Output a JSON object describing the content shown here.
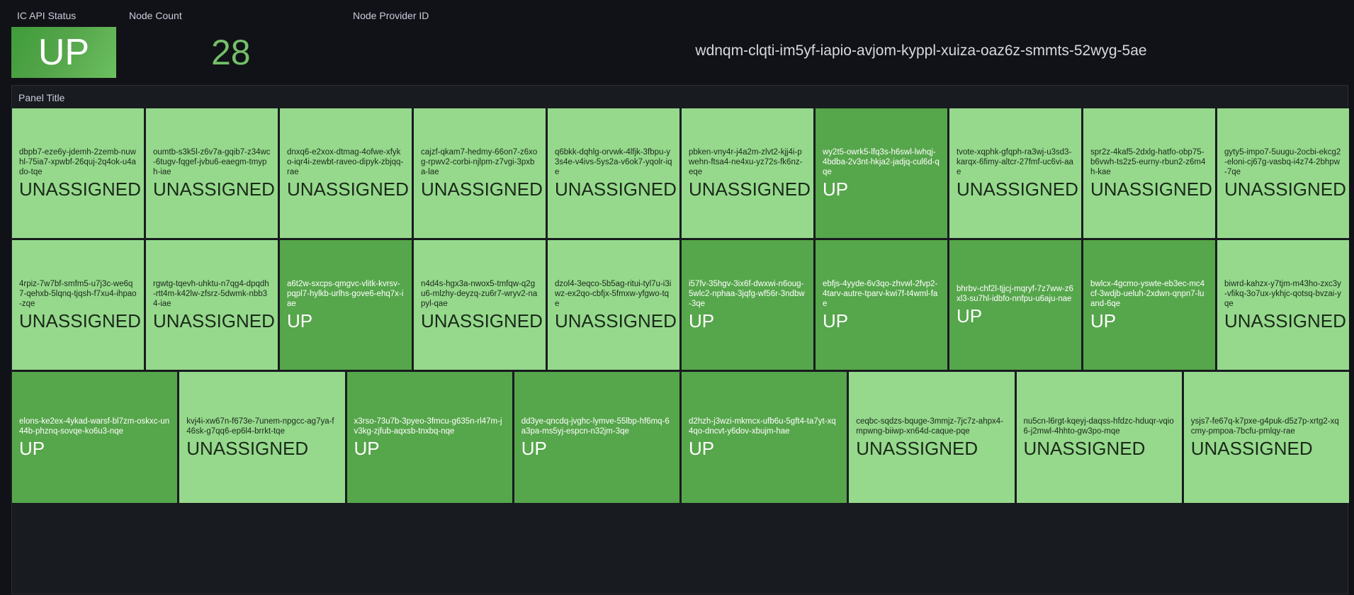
{
  "header": {
    "api_status_label": "IC API Status",
    "api_status_value": "UP",
    "node_count_label": "Node Count",
    "node_count_value": "28",
    "provider_label": "Node Provider ID",
    "provider_value": "wdnqm-clqti-im5yf-iapio-avjom-kyppl-xuiza-oaz6z-smmts-52wyg-5ae"
  },
  "colors": {
    "up": "#56a64b",
    "unassigned": "#96d98d",
    "count": "#73bf69",
    "background": "#111217"
  },
  "panel": {
    "title": "Panel Title",
    "rows": [
      [
        {
          "id": "dbpb7-eze6y-jdemh-2zemb-nuwhl-75ia7-xpwbf-26quj-2q4ok-u4ado-tqe",
          "status": "UNASSIGNED"
        },
        {
          "id": "oumtb-s3k5l-z6v7a-gqib7-z34wc-6tugv-fqgef-jvbu6-eaegm-tmyph-iae",
          "status": "UNASSIGNED"
        },
        {
          "id": "dnxq6-e2xox-dtmag-4ofwe-xfyko-iqr4i-zewbt-raveo-dipyk-zbjqq-rae",
          "status": "UNASSIGNED"
        },
        {
          "id": "cajzf-qkam7-hedmy-66on7-z6xog-rpwv2-corbi-njlpm-z7vgi-3pxba-lae",
          "status": "UNASSIGNED"
        },
        {
          "id": "q6bkk-dqhlg-orvwk-4lfjk-3fbpu-y3s4e-v4ivs-5ys2a-v6ok7-yqolr-iqe",
          "status": "UNASSIGNED"
        },
        {
          "id": "pbken-vny4r-j4a2m-zlvt2-kjj4i-pwehn-ftsa4-ne4xu-yz72s-fk6nz-eqe",
          "status": "UNASSIGNED"
        },
        {
          "id": "wy2t5-owrk5-lfq3s-h6swl-lwhqj-4bdba-2v3nt-hkja2-jadjq-cul6d-qqe",
          "status": "UP"
        },
        {
          "id": "tvote-xqphk-gfqph-ra3wj-u3sd3-karqx-6fimy-altcr-27fmf-uc6vi-aae",
          "status": "UNASSIGNED"
        },
        {
          "id": "spr2z-4kaf5-2dxlg-hatfo-obp75-b6vwh-ts2z5-eurny-rbun2-z6m4h-kae",
          "status": "UNASSIGNED"
        },
        {
          "id": "gyty5-impo7-5uugu-2ocbi-ekcg2-eloni-cj67g-vasbq-i4z74-2bhpw-7qe",
          "status": "UNASSIGNED"
        }
      ],
      [
        {
          "id": "4rpiz-7w7bf-smfm5-u7j3c-we6q7-qehxb-5lqnq-tjqsh-f7xu4-ihpao-zqe",
          "status": "UNASSIGNED"
        },
        {
          "id": "rgwtg-tqevh-uhktu-n7qg4-dpqdh-rtt4m-k42lw-zfsrz-5dwmk-nbb34-iae",
          "status": "UNASSIGNED"
        },
        {
          "id": "a6t2w-sxcps-qmgvc-vlitk-kvrsv-pqpl7-hylkb-urlhs-gove6-ehq7x-iae",
          "status": "UP"
        },
        {
          "id": "n4d4s-hgx3a-nwox5-tmfqw-q2gu6-mlzhy-deyzq-zu6r7-wryv2-napyl-qae",
          "status": "UNASSIGNED"
        },
        {
          "id": "dzol4-3eqco-5b5ag-ritui-tyl7u-i3iwz-ex2qo-cbfjx-5fmxw-yfgwo-tqe",
          "status": "UNASSIGNED"
        },
        {
          "id": "i57fv-35hgv-3ix6f-dwxwi-n6oug-5wlc2-nphaa-3jqfg-wf56r-3ndbw-3qe",
          "status": "UP"
        },
        {
          "id": "ebfjs-4yyde-6v3qo-zhvwl-2fvp2-4tarv-autre-tparv-kwi7f-t4wml-fae",
          "status": "UP"
        },
        {
          "id": "bhrbv-chf2l-tjjcj-mqryf-7z7ww-z6xl3-su7hl-idbfo-nnfpu-u6aju-nae",
          "status": "UP"
        },
        {
          "id": "bwlcx-4gcmo-yswte-eb3ec-mc4cf-3wdjb-ueluh-2xdwn-qnpn7-luand-6qe",
          "status": "UP"
        },
        {
          "id": "biwrd-kahzx-y7tjm-m43ho-zxc3y-vfikq-3o7ux-ykhjc-qotsq-bvzai-yqe",
          "status": "UNASSIGNED"
        }
      ],
      [
        {
          "id": "elons-ke2ex-4ykad-warsf-bl7zm-oskxc-un44b-phznq-sovqe-ko6u3-nqe",
          "status": "UP"
        },
        {
          "id": "kvj4i-xw67n-f673e-7unem-npgcc-ag7ya-f46sk-g7qq6-ep6l4-brrkt-tqe",
          "status": "UNASSIGNED"
        },
        {
          "id": "x3rso-73u7b-3pyeo-3fmcu-g635n-rl47m-jv3kg-zjfub-aqxsb-tnxbq-nqe",
          "status": "UP"
        },
        {
          "id": "dd3ye-qncdq-jvghc-lymve-55lbp-hf6mq-6a3pa-ms5yj-espcn-n32jm-3qe",
          "status": "UP"
        },
        {
          "id": "d2hzh-j3wzi-mkmcx-ufb6u-5gft4-ta7yt-xq4qo-dncvt-y6dov-xbujm-hae",
          "status": "UP"
        },
        {
          "id": "ceqbc-sqdzs-bquge-3mmjz-7jc7z-ahpx4-mpwng-biiwp-xn64d-caque-pqe",
          "status": "UNASSIGNED"
        },
        {
          "id": "nu5cn-l6rgt-kqeyj-daqss-hfdzc-hduqr-vqio6-j2mwl-4hhto-gw3po-mqe",
          "status": "UNASSIGNED"
        },
        {
          "id": "ysjs7-fe67q-k7pxe-g4puk-d5z7p-xrtg2-xqcmy-pmpoa-7bcfu-pmlqy-rae",
          "status": "UNASSIGNED"
        }
      ]
    ]
  }
}
